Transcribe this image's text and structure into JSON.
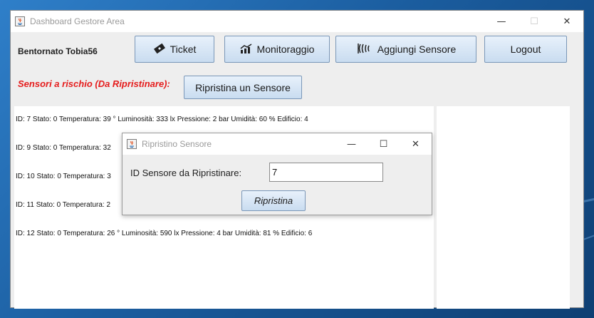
{
  "window": {
    "title": "Dashboard Gestore Area",
    "controls": {
      "minimize": "—",
      "maximize": "☐",
      "close": "✕"
    }
  },
  "header": {
    "user_label": "Bentornato Tobia56",
    "buttons": {
      "ticket": "Ticket",
      "monitoraggio": "Monitoraggio",
      "aggiungi": "Aggiungi Sensore",
      "logout": "Logout"
    }
  },
  "risk": {
    "label": "Sensori a rischio (Da Ripristinare):",
    "button": "Ripristina un Sensore",
    "label_color": "#e51b1b"
  },
  "sensors": [
    "ID: 7 Stato: 0 Temperatura: 39 ° Luminosità: 333 lx Pressione: 2 bar Umidità: 60 % Edificio: 4",
    "ID: 9 Stato: 0 Temperatura: 32",
    "ID: 10 Stato: 0 Temperatura: 3",
    "ID: 11 Stato: 0 Temperatura: 2",
    "ID: 12 Stato: 0 Temperatura: 26 ° Luminosità: 590 lx Pressione: 4 bar Umidità: 81 % Edificio: 6"
  ],
  "dialog": {
    "title": "Ripristino Sensore",
    "field_label": "ID Sensore da Ripristinare:",
    "field_value": "7",
    "submit": "Ripristina",
    "controls": {
      "minimize": "—",
      "maximize": "☐",
      "close": "✕"
    }
  },
  "icons": {
    "app": "java-app-icon",
    "ticket": "ticket-icon",
    "monitoraggio": "chart-trend-icon",
    "aggiungi": "sensor-waves-icon"
  }
}
